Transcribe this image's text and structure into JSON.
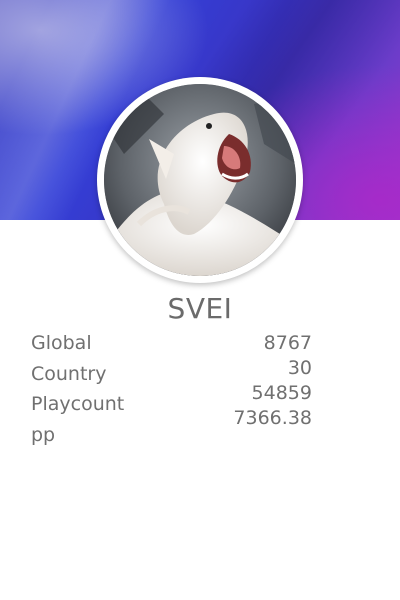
{
  "profile": {
    "username": "SVEI",
    "avatar_icon": "cat-avatar-photo"
  },
  "stats": {
    "labels": {
      "global": "Global",
      "country": "Country",
      "playcount": "Playcount",
      "pp": "pp"
    },
    "values": {
      "global": "8767",
      "country": "30",
      "playcount": "54859",
      "pp": "7366.38"
    }
  },
  "colors": {
    "banner_blue": "#3340d8",
    "banner_purple": "#9a39cf",
    "text_gray": "#707070"
  }
}
